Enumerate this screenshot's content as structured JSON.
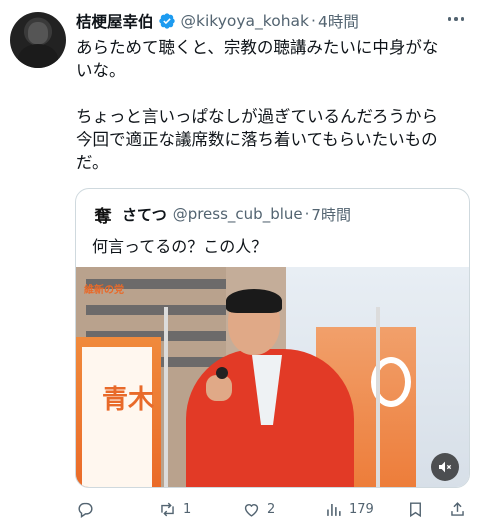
{
  "tweet": {
    "display_name": "桔梗屋幸伯",
    "handle": "@kikyoya_kohak",
    "time": "4時間",
    "text_lines": [
      "あらためて聴くと、宗教の聴講みたいに中身がな",
      "いな。",
      "ちょっと言いっぱなしが過ぎているんだろうから",
      "今回で適正な議席数に落ち着いてもらいたいもの",
      "だ。"
    ]
  },
  "quote": {
    "avatar_glyph": "奪",
    "display_name": "さてつ",
    "handle": "@press_cub_blue",
    "time": "7時間",
    "text": "何言ってるの？この人？",
    "banner_left_text": "青木",
    "banner_logo_text": "維新の党"
  },
  "actions": {
    "reply_icon": "reply-icon",
    "retweet_count": "1",
    "like_count": "2",
    "views_count": "179"
  },
  "colors": {
    "text": "#0f1419",
    "secondary": "#536471",
    "verified": "#1d9bf0",
    "border": "#cfd9de"
  }
}
